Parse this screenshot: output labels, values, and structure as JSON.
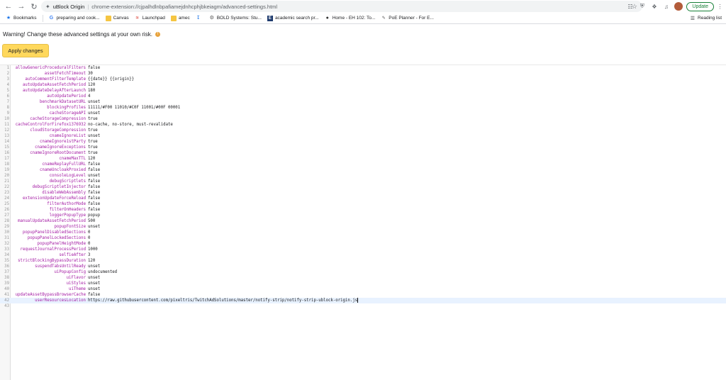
{
  "toolbar": {
    "site_name": "uBlock Origin",
    "url": "chrome-extension://cjpalhdlnbpafiamejdnhcphjbkeiagm/advanced-settings.html",
    "update_label": "Update"
  },
  "bookmarks": {
    "label": "Bookmarks",
    "items": [
      {
        "label": "preparing and cook...",
        "icon": "google-icon"
      },
      {
        "label": "Canvas",
        "icon": "folder-icon"
      },
      {
        "label": "Launchpad",
        "icon": "launchpad-icon"
      },
      {
        "label": "amec",
        "icon": "folder-icon"
      },
      {
        "label": "",
        "icon": "download-icon"
      },
      {
        "label": "BOLD Systems: Stu...",
        "icon": "bold-icon"
      },
      {
        "label": "academic search pr...",
        "icon": "academic-icon"
      },
      {
        "label": "Home - EH 102: To...",
        "icon": "globe-icon"
      },
      {
        "label": "PoE Planner - For E...",
        "icon": "poe-icon"
      }
    ],
    "reading_list": "Reading list"
  },
  "warning_text": "Warning! Change these advanced settings at your own risk.",
  "apply_label": "Apply changes",
  "settings": [
    {
      "n": "1",
      "k": "allowGenericProceduralFilters",
      "v": "false"
    },
    {
      "n": "2",
      "k": "assetFetchTimeout",
      "v": "30"
    },
    {
      "n": "3",
      "k": "autoCommentFilterTemplate",
      "v": "{{date}} {{origin}}"
    },
    {
      "n": "4",
      "k": "autoUpdateAssetFetchPeriod",
      "v": "120"
    },
    {
      "n": "5",
      "k": "autoUpdateDelayAfterLaunch",
      "v": "180"
    },
    {
      "n": "6",
      "k": "autoUpdatePeriod",
      "v": "4"
    },
    {
      "n": "7",
      "k": "benchmarkDatasetURL",
      "v": "unset"
    },
    {
      "n": "8",
      "k": "blockingProfiles",
      "v": "11111/#F00 11010/#C0F 11001/#00F 00001"
    },
    {
      "n": "9",
      "k": "cacheStorageAPI",
      "v": "unset"
    },
    {
      "n": "10",
      "k": "cacheStorageCompression",
      "v": "true"
    },
    {
      "n": "11",
      "k": "cacheControlForFirefox1376932",
      "v": "no-cache, no-store, must-revalidate"
    },
    {
      "n": "12",
      "k": "cloudStorageCompression",
      "v": "true"
    },
    {
      "n": "13",
      "k": "cnameIgnoreList",
      "v": "unset"
    },
    {
      "n": "14",
      "k": "cnameIgnore1stParty",
      "v": "true"
    },
    {
      "n": "15",
      "k": "cnameIgnoreExceptions",
      "v": "true"
    },
    {
      "n": "16",
      "k": "cnameIgnoreRootDocument",
      "v": "true"
    },
    {
      "n": "17",
      "k": "cnameMaxTTL",
      "v": "120"
    },
    {
      "n": "18",
      "k": "cnameReplayFullURL",
      "v": "false"
    },
    {
      "n": "19",
      "k": "cnameUncloakProxied",
      "v": "false"
    },
    {
      "n": "20",
      "k": "consoleLogLevel",
      "v": "unset"
    },
    {
      "n": "21",
      "k": "debugScriptlets",
      "v": "false"
    },
    {
      "n": "22",
      "k": "debugScriptletInjector",
      "v": "false"
    },
    {
      "n": "23",
      "k": "disableWebAssembly",
      "v": "false"
    },
    {
      "n": "24",
      "k": "extensionUpdateForceReload",
      "v": "false"
    },
    {
      "n": "25",
      "k": "filterAuthorMode",
      "v": "false"
    },
    {
      "n": "26",
      "k": "filterOnHeaders",
      "v": "false"
    },
    {
      "n": "27",
      "k": "loggerPopupType",
      "v": "popup"
    },
    {
      "n": "28",
      "k": "manualUpdateAssetFetchPeriod",
      "v": "500"
    },
    {
      "n": "29",
      "k": "popupFontSize",
      "v": "unset"
    },
    {
      "n": "30",
      "k": "popupPanelDisabledSections",
      "v": "0"
    },
    {
      "n": "31",
      "k": "popupPanelLockedSections",
      "v": "0"
    },
    {
      "n": "32",
      "k": "popupPanelHeightMode",
      "v": "0"
    },
    {
      "n": "33",
      "k": "requestJournalProcessPeriod",
      "v": "1000"
    },
    {
      "n": "34",
      "k": "selfieAfter",
      "v": "3"
    },
    {
      "n": "35",
      "k": "strictBlockingBypassDuration",
      "v": "120"
    },
    {
      "n": "36",
      "k": "suspendTabsUntilReady",
      "v": "unset"
    },
    {
      "n": "37",
      "k": "uiPopupConfig",
      "v": "undocumented"
    },
    {
      "n": "38",
      "k": "uiFlavor",
      "v": "unset"
    },
    {
      "n": "39",
      "k": "uiStyles",
      "v": "unset"
    },
    {
      "n": "40",
      "k": "uiTheme",
      "v": "unset"
    },
    {
      "n": "41",
      "k": "updateAssetBypassBrowserCache",
      "v": "false"
    },
    {
      "n": "42",
      "k": "userResourcesLocation",
      "v": "https://raw.githubusercontent.com/pixeltris/TwitchAdSolutions/master/notify-strip/notify-strip-ublock-origin.js"
    },
    {
      "n": "43",
      "k": "",
      "v": ""
    }
  ],
  "active_line": 42,
  "colors": {
    "key": "#a31aa3",
    "apply_button": "#ffd85c",
    "update": "#188038"
  }
}
